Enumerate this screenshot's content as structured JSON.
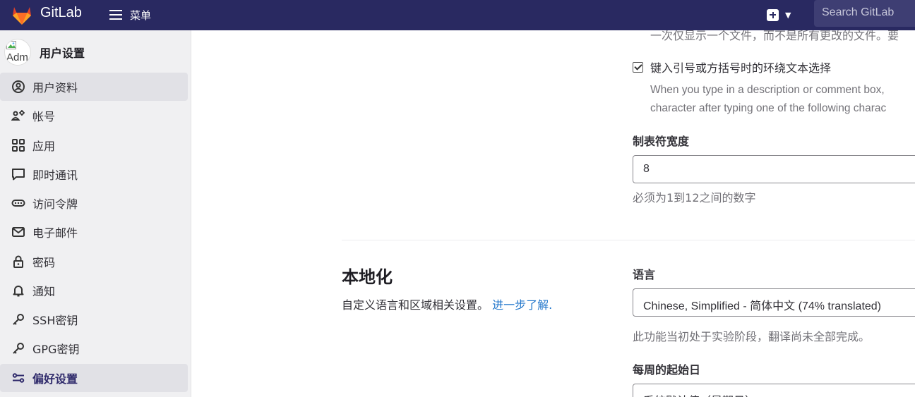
{
  "topbar": {
    "brand": "GitLab",
    "menu_label": "菜单",
    "search_placeholder": "Search GitLab"
  },
  "sidebar": {
    "avatar_alt": "Adm",
    "title": "用户设置",
    "items": [
      {
        "label": "用户资料",
        "icon": "profile-icon"
      },
      {
        "label": "帐号",
        "icon": "account-icon"
      },
      {
        "label": "应用",
        "icon": "applications-icon"
      },
      {
        "label": "即时通讯",
        "icon": "chat-icon"
      },
      {
        "label": "访问令牌",
        "icon": "token-icon"
      },
      {
        "label": "电子邮件",
        "icon": "mail-icon"
      },
      {
        "label": "密码",
        "icon": "lock-icon"
      },
      {
        "label": "通知",
        "icon": "bell-icon"
      },
      {
        "label": "SSH密钥",
        "icon": "key-icon"
      },
      {
        "label": "GPG密钥",
        "icon": "key-icon"
      },
      {
        "label": "偏好设置",
        "icon": "preferences-icon"
      }
    ]
  },
  "main": {
    "cut_text": "一次仅显示一个文件，而不是所有更改的文件。要",
    "surround_selection": {
      "label": "键入引号或方括号时的环绕文本选择",
      "checked": true,
      "help_line1": "When you type in a description or comment box,",
      "help_line2": "character after typing one of the following charac"
    },
    "tab_width": {
      "label": "制表符宽度",
      "value": "8",
      "hint": "必须为1到12之间的数字"
    },
    "localization": {
      "title": "本地化",
      "description": "自定义语言和区域相关设置。",
      "learn_more": "进一步了解."
    },
    "language": {
      "label": "语言",
      "value": "Chinese, Simplified - 简体中文 (74% translated)",
      "hint": "此功能当初处于实验阶段，翻译尚未全部完成。"
    },
    "first_day": {
      "label": "每周的起始日",
      "value": "系统默认值（星期日）"
    }
  }
}
